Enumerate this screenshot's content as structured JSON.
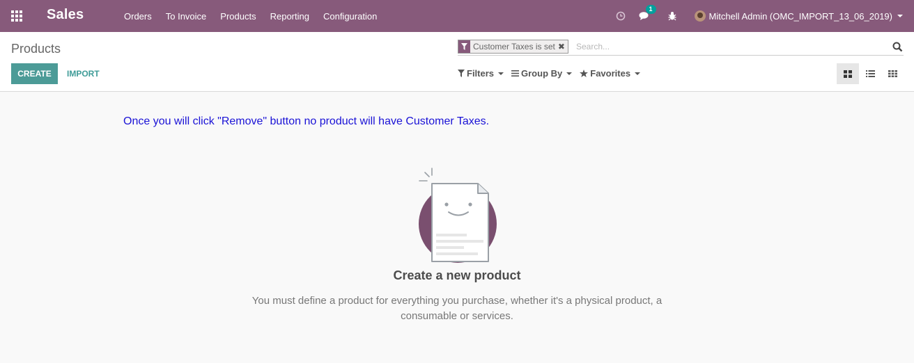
{
  "navbar": {
    "brand": "Sales",
    "menu": [
      "Orders",
      "To Invoice",
      "Products",
      "Reporting",
      "Configuration"
    ],
    "messages_badge": "1",
    "user_name": "Mitchell Admin (OMC_IMPORT_13_06_2019)",
    "icons": [
      "apps-icon",
      "clock-icon",
      "chat-icon",
      "bug-icon"
    ]
  },
  "control_panel": {
    "breadcrumb": "Products",
    "create_label": "CREATE",
    "import_label": "IMPORT",
    "search": {
      "facet_label": "Customer Taxes is set",
      "placeholder": "Search..."
    },
    "filters_label": "Filters",
    "group_by_label": "Group By",
    "favorites_label": "Favorites",
    "active_view": "kanban"
  },
  "content": {
    "warning": "Once you will click \"Remove\" button no product will have Customer Taxes.",
    "help_title": "Create a new product",
    "help_description": "You must define a product for everything you purchase, whether it's a physical product, a consumable or services."
  },
  "colors": {
    "navbar": "#875a7b",
    "primary": "#00a09d",
    "warning_text": "#1a12d6"
  }
}
